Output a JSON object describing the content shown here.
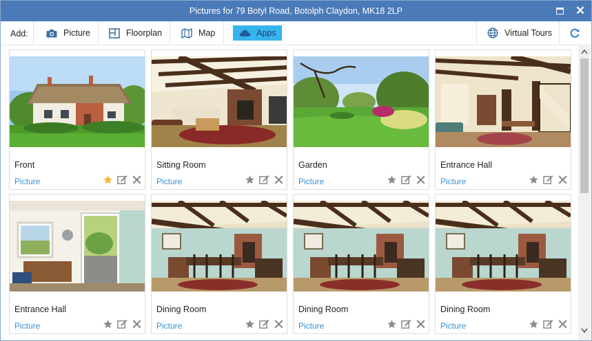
{
  "window": {
    "title": "Pictures for 79 Botyl Road, Botolph Claydon, MK18 2LP"
  },
  "toolbar": {
    "add_label": "Add:",
    "picture_label": "Picture",
    "floorplan_label": "Floorplan",
    "map_label": "Map",
    "apps_label": "Apps",
    "virtual_tours_label": "Virtual Tours"
  },
  "colors": {
    "titlebar": "#4a7ab8",
    "accent": "#35b4ee",
    "link": "#3a8fd0",
    "star_active": "#f2b533",
    "icon_grey": "#8a8a8a"
  },
  "pictures": [
    {
      "caption": "Front",
      "type": "Picture",
      "starred": true,
      "scene": "house-exterior"
    },
    {
      "caption": "Sitting Room",
      "type": "Picture",
      "starred": false,
      "scene": "beamed-lounge"
    },
    {
      "caption": "Garden",
      "type": "Picture",
      "starred": false,
      "scene": "garden"
    },
    {
      "caption": "Entrance Hall",
      "type": "Picture",
      "starred": false,
      "scene": "beamed-hall"
    },
    {
      "caption": "Entrance Hall",
      "type": "Picture",
      "starred": false,
      "scene": "doorway"
    },
    {
      "caption": "Dining Room",
      "type": "Picture",
      "starred": false,
      "scene": "beamed-dining"
    },
    {
      "caption": "Dining Room",
      "type": "Picture",
      "starred": false,
      "scene": "beamed-dining"
    },
    {
      "caption": "Dining Room",
      "type": "Picture",
      "starred": false,
      "scene": "beamed-dining"
    }
  ]
}
